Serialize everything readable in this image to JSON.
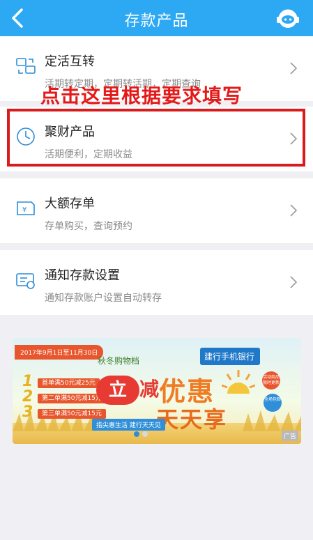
{
  "header": {
    "title": "存款产品"
  },
  "items": [
    {
      "title": "定活互转",
      "subtitle": "活期转定期，定期转活期，定期查询"
    },
    {
      "title": "聚财产品",
      "subtitle": "活期便利，定期收益"
    },
    {
      "title": "大额存单",
      "subtitle": "存单购买，查询预约"
    },
    {
      "title": "通知存款设置",
      "subtitle": "通知存款账户设置自动转存"
    }
  ],
  "annotation": {
    "text": "点击这里根据要求填写"
  },
  "banner": {
    "date_range": "2017年9月1日至11月30日",
    "autumn_label": "秋冬购物档",
    "bank_name": "建行手机银行",
    "rules": [
      {
        "num": "1",
        "text": "首单满50元减25元"
      },
      {
        "num": "2",
        "text": "第二单满50元减15元"
      },
      {
        "num": "3",
        "text": "第三单满50元减15元"
      }
    ],
    "li": "立",
    "jian": "减",
    "youhui": "优惠",
    "tiantian": "天天享",
    "slogan": "指尖惠生活  建行天天见",
    "badge_1": "活动商品限时更新",
    "badge_2": "全场包邮",
    "ad_label": "广告"
  },
  "colors": {
    "header": "#2da8f2",
    "accent_red": "#d91b1b",
    "icon_blue": "#2d8dd6"
  }
}
